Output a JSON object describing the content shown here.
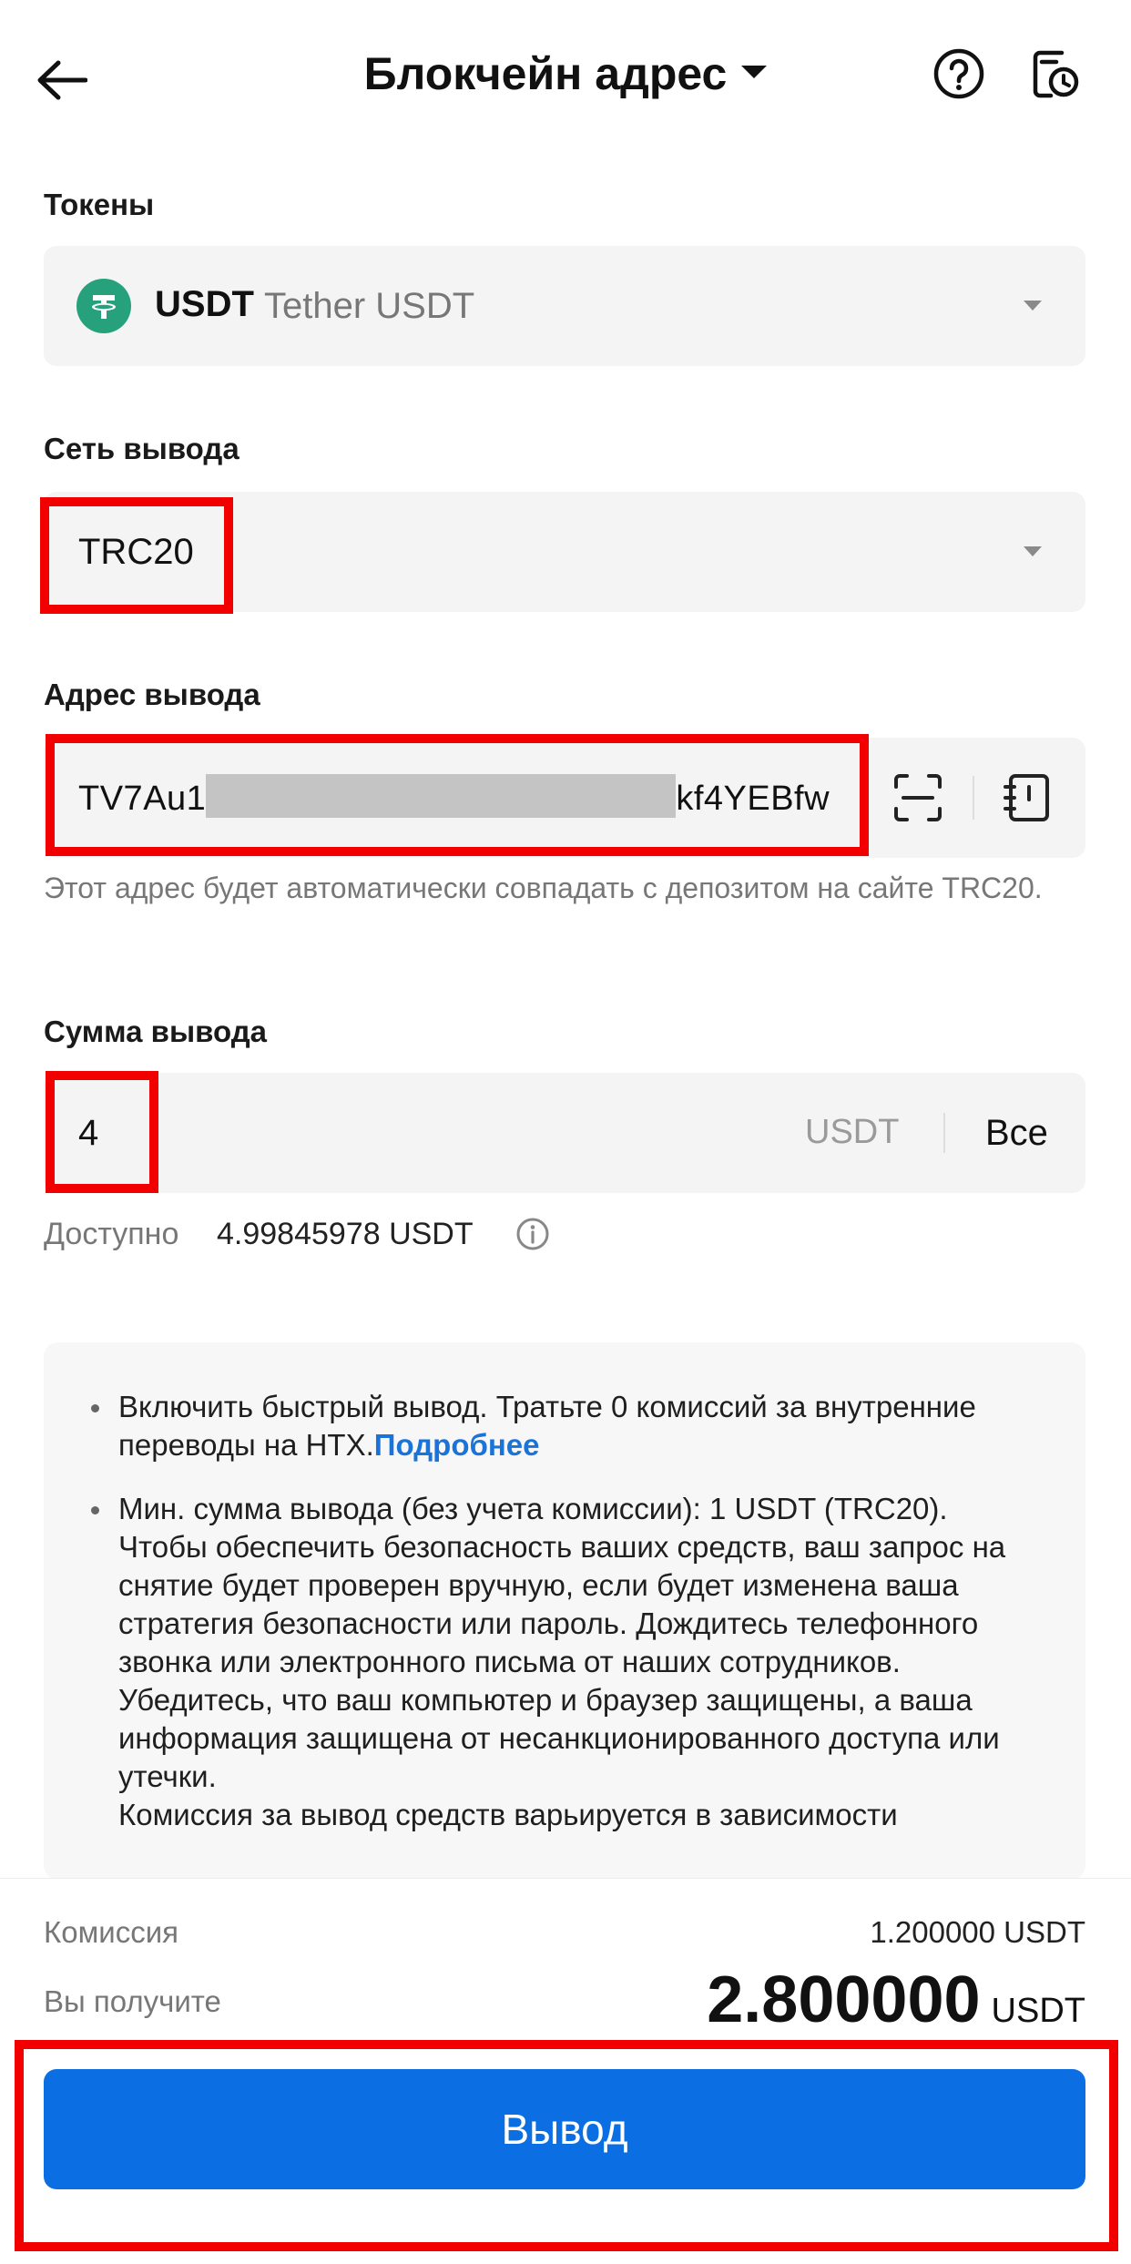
{
  "header": {
    "title": "Блокчейн адрес",
    "back_icon": "arrow-left-icon",
    "help_icon": "question-circle-icon",
    "history_icon": "history-clock-icon"
  },
  "token": {
    "label": "Токены",
    "symbol": "USDT",
    "name": "Tether USDT",
    "icon": "tether-icon",
    "color": "#26a17b"
  },
  "network": {
    "label": "Сеть вывода",
    "value": "TRC20"
  },
  "address": {
    "label": "Адрес вывода",
    "value_start": "TV7Au1",
    "value_end": "kf4YEBfw",
    "hint": "Этот адрес будет автоматически совпадать с депозитом на сайте TRC20.",
    "scan_icon": "scan-icon",
    "book_icon": "address-book-icon"
  },
  "amount": {
    "label": "Сумма вывода",
    "value": "4",
    "unit": "USDT",
    "all_label": "Все",
    "available_label": "Доступно",
    "available_value": "4.99845978 USDT"
  },
  "notice": {
    "item1_text": "Включить быстрый вывод. Тратьте 0 комиссий за внутренние переводы на HTX.",
    "item1_link": "Подробнее",
    "item2_line1": "Мин. сумма вывода (без учета комиссии): 1 USDT (TRC20).",
    "item2_line2": "Чтобы обеспечить безопасность ваших средств, ваш запрос на снятие будет проверен вручную, если будет изменена ваша стратегия безопасности или пароль. Дождитесь телефонного звонка или электронного письма от наших сотрудников.",
    "item2_line3": "Убедитесь, что ваш компьютер и браузер защищены, а ваша информация защищена от несанкционированного доступа или утечки.",
    "item2_line4": "Комиссия за вывод средств варьируется в зависимости"
  },
  "summary": {
    "fee_label": "Комиссия",
    "fee_value": "1.200000 USDT",
    "receive_label": "Вы получите",
    "receive_value": "2.800000",
    "receive_unit": "USDT"
  },
  "submit": {
    "label": "Вывод",
    "color": "#0b6fe3"
  },
  "highlight_color": "#f20000"
}
